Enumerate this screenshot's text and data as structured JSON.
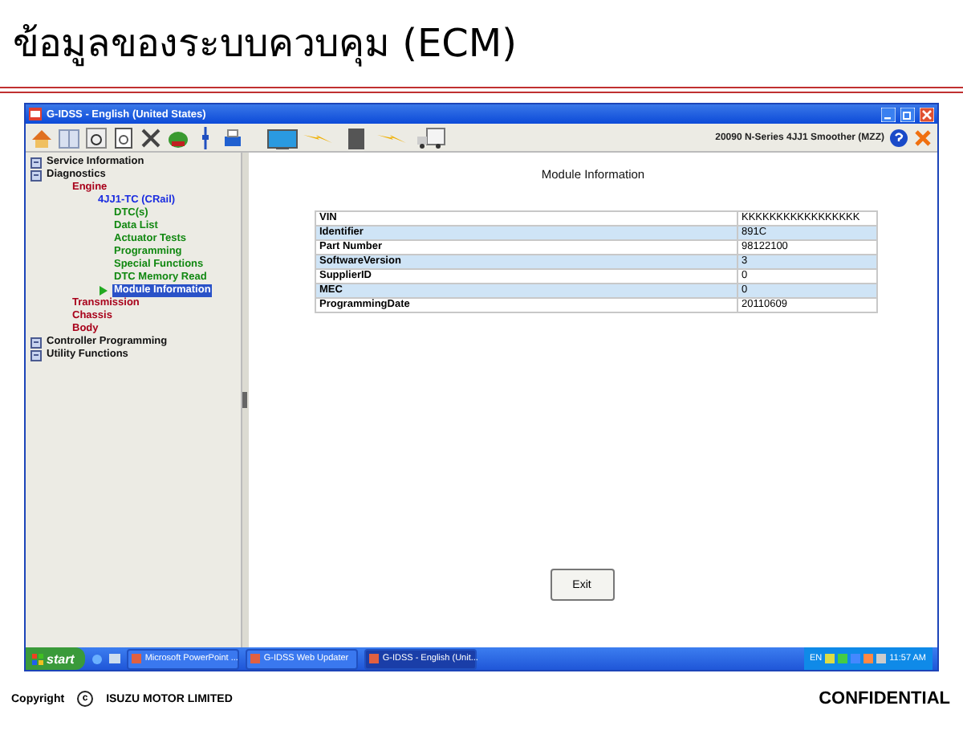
{
  "slide": {
    "title": "ข้อมูลของระบบควบคุม (ECM)",
    "footer_left": "Copyright",
    "footer_mark": "c",
    "footer_company": "ISUZU MOTOR LIMITED",
    "footer_right": "CONFIDENTIAL"
  },
  "window": {
    "title": "G-IDSS - English (United States)",
    "vehicle": "20090 N-Series 4JJ1 Smoother (MZZ)"
  },
  "tree": [
    {
      "label": "Service Information",
      "selected": false
    },
    {
      "label": "Diagnostics",
      "selected": false,
      "children": [
        {
          "label": "Engine",
          "selected": false,
          "children": [
            {
              "label": "4JJ1-TC (CRail)",
              "selected": false,
              "children": [
                {
                  "label": "DTC(s)",
                  "selected": false
                },
                {
                  "label": "Data List",
                  "selected": false
                },
                {
                  "label": "Actuator Tests",
                  "selected": false
                },
                {
                  "label": "Programming",
                  "selected": false
                },
                {
                  "label": "Special Functions",
                  "selected": false
                },
                {
                  "label": "DTC Memory Read",
                  "selected": false
                },
                {
                  "label": "Module Information",
                  "selected": true
                }
              ]
            }
          ]
        },
        {
          "label": "Transmission",
          "selected": false
        },
        {
          "label": "Chassis",
          "selected": false
        },
        {
          "label": "Body",
          "selected": false
        }
      ]
    },
    {
      "label": "Controller Programming",
      "selected": false
    },
    {
      "label": "Utility Functions",
      "selected": false
    }
  ],
  "content": {
    "heading": "Module Information",
    "rows": [
      {
        "label": "VIN",
        "value": "KKKKKKKKKKKKKKKKK"
      },
      {
        "label": "Identifier",
        "value": "891C"
      },
      {
        "label": "Part Number",
        "value": "98122100"
      },
      {
        "label": "SoftwareVersion",
        "value": "3"
      },
      {
        "label": "SupplierID",
        "value": "0"
      },
      {
        "label": "MEC",
        "value": "0"
      },
      {
        "label": "ProgrammingDate",
        "value": "20110609"
      }
    ],
    "exit_button": "Exit"
  },
  "taskbar": {
    "start": "start",
    "tasks": [
      {
        "label": "Microsoft PowerPoint ...",
        "selected": false
      },
      {
        "label": "G-IDSS Web Updater",
        "selected": false
      },
      {
        "label": "G-IDSS - English (Unit...",
        "selected": true
      }
    ],
    "language": "EN",
    "clock": "11:57 AM"
  }
}
